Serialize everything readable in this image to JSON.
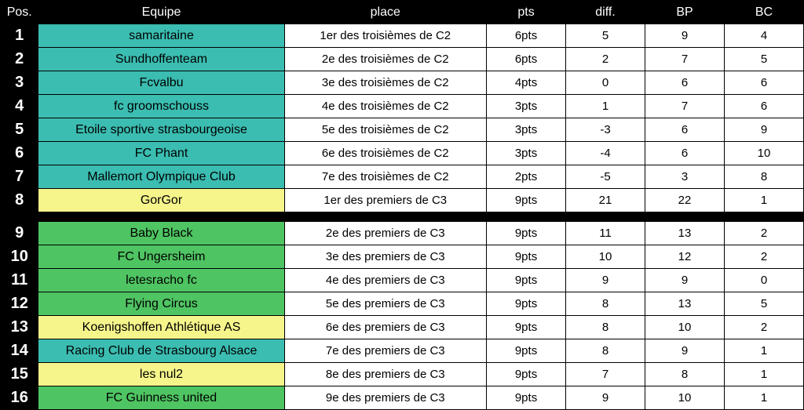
{
  "header": {
    "pos": "Pos.",
    "team": "Equipe",
    "place": "place",
    "pts": "pts",
    "diff": "diff.",
    "bp": "BP",
    "bc": "BC"
  },
  "rows": [
    {
      "pos": 1,
      "team": "samaritaine",
      "place": "1er des troisièmes de C2",
      "pts": "6pts",
      "diff": "5",
      "bp": "9",
      "bc": "4",
      "color": "teal"
    },
    {
      "pos": 2,
      "team": "Sundhoffenteam",
      "place": "2e des troisièmes de C2",
      "pts": "6pts",
      "diff": "2",
      "bp": "7",
      "bc": "5",
      "color": "teal"
    },
    {
      "pos": 3,
      "team": "Fcvalbu",
      "place": "3e des troisièmes de C2",
      "pts": "4pts",
      "diff": "0",
      "bp": "6",
      "bc": "6",
      "color": "teal"
    },
    {
      "pos": 4,
      "team": "fc groomschouss",
      "place": "4e des troisièmes de C2",
      "pts": "3pts",
      "diff": "1",
      "bp": "7",
      "bc": "6",
      "color": "teal"
    },
    {
      "pos": 5,
      "team": "Etoile sportive strasbourgeoise",
      "place": "5e des troisièmes de C2",
      "pts": "3pts",
      "diff": "-3",
      "bp": "6",
      "bc": "9",
      "color": "teal"
    },
    {
      "pos": 6,
      "team": "FC Phant",
      "place": "6e des troisièmes de C2",
      "pts": "3pts",
      "diff": "-4",
      "bp": "6",
      "bc": "10",
      "color": "teal"
    },
    {
      "pos": 7,
      "team": "Mallemort Olympique Club",
      "place": "7e des troisièmes de C2",
      "pts": "2pts",
      "diff": "-5",
      "bp": "3",
      "bc": "8",
      "color": "teal"
    },
    {
      "pos": 8,
      "team": "GorGor",
      "place": "1er des premiers de C3",
      "pts": "9pts",
      "diff": "21",
      "bp": "22",
      "bc": "1",
      "color": "yellow"
    },
    {
      "gap": true
    },
    {
      "pos": 9,
      "team": "Baby Black",
      "place": "2e des premiers de C3",
      "pts": "9pts",
      "diff": "11",
      "bp": "13",
      "bc": "2",
      "color": "green"
    },
    {
      "pos": 10,
      "team": "FC Ungersheim",
      "place": "3e des premiers de C3",
      "pts": "9pts",
      "diff": "10",
      "bp": "12",
      "bc": "2",
      "color": "green"
    },
    {
      "pos": 11,
      "team": "letesracho fc",
      "place": "4e des premiers de C3",
      "pts": "9pts",
      "diff": "9",
      "bp": "9",
      "bc": "0",
      "color": "green"
    },
    {
      "pos": 12,
      "team": "Flying Circus",
      "place": "5e des premiers de C3",
      "pts": "9pts",
      "diff": "8",
      "bp": "13",
      "bc": "5",
      "color": "green"
    },
    {
      "pos": 13,
      "team": "Koenigshoffen Athlétique AS",
      "place": "6e des premiers de C3",
      "pts": "9pts",
      "diff": "8",
      "bp": "10",
      "bc": "2",
      "color": "yellow"
    },
    {
      "pos": 14,
      "team": "Racing Club de Strasbourg Alsace",
      "place": "7e des premiers de C3",
      "pts": "9pts",
      "diff": "8",
      "bp": "9",
      "bc": "1",
      "color": "teal"
    },
    {
      "pos": 15,
      "team": "les nul2",
      "place": "8e des premiers de C3",
      "pts": "9pts",
      "diff": "7",
      "bp": "8",
      "bc": "1",
      "color": "yellow"
    },
    {
      "pos": 16,
      "team": "FC Guinness united",
      "place": "9e des premiers de C3",
      "pts": "9pts",
      "diff": "9",
      "bp": "10",
      "bc": "1",
      "color": "green"
    }
  ],
  "chart_data": {
    "type": "table",
    "title": "",
    "columns": [
      "Pos.",
      "Equipe",
      "place",
      "pts",
      "diff.",
      "BP",
      "BC"
    ],
    "groups": [
      {
        "range": "1-7",
        "description": "troisièmes de C2",
        "team_cell_color": "#3bbdb1"
      },
      {
        "range": "8",
        "description": "premiers de C3",
        "team_cell_color": "#f6f58b"
      },
      {
        "range": "9-16",
        "description": "premiers de C3 (continued)",
        "team_cell_color": "mixed"
      }
    ],
    "rows": [
      {
        "Pos.": 1,
        "Equipe": "samaritaine",
        "place": "1er des troisièmes de C2",
        "pts": 6,
        "diff.": 5,
        "BP": 9,
        "BC": 4
      },
      {
        "Pos.": 2,
        "Equipe": "Sundhoffenteam",
        "place": "2e des troisièmes de C2",
        "pts": 6,
        "diff.": 2,
        "BP": 7,
        "BC": 5
      },
      {
        "Pos.": 3,
        "Equipe": "Fcvalbu",
        "place": "3e des troisièmes de C2",
        "pts": 4,
        "diff.": 0,
        "BP": 6,
        "BC": 6
      },
      {
        "Pos.": 4,
        "Equipe": "fc groomschouss",
        "place": "4e des troisièmes de C2",
        "pts": 3,
        "diff.": 1,
        "BP": 7,
        "BC": 6
      },
      {
        "Pos.": 5,
        "Equipe": "Etoile sportive strasbourgeoise",
        "place": "5e des troisièmes de C2",
        "pts": 3,
        "diff.": -3,
        "BP": 6,
        "BC": 9
      },
      {
        "Pos.": 6,
        "Equipe": "FC Phant",
        "place": "6e des troisièmes de C2",
        "pts": 3,
        "diff.": -4,
        "BP": 6,
        "BC": 10
      },
      {
        "Pos.": 7,
        "Equipe": "Mallemort Olympique Club",
        "place": "7e des troisièmes de C2",
        "pts": 2,
        "diff.": -5,
        "BP": 3,
        "BC": 8
      },
      {
        "Pos.": 8,
        "Equipe": "GorGor",
        "place": "1er des premiers de C3",
        "pts": 9,
        "diff.": 21,
        "BP": 22,
        "BC": 1
      },
      {
        "Pos.": 9,
        "Equipe": "Baby Black",
        "place": "2e des premiers de C3",
        "pts": 9,
        "diff.": 11,
        "BP": 13,
        "BC": 2
      },
      {
        "Pos.": 10,
        "Equipe": "FC Ungersheim",
        "place": "3e des premiers de C3",
        "pts": 9,
        "diff.": 10,
        "BP": 12,
        "BC": 2
      },
      {
        "Pos.": 11,
        "Equipe": "letesracho fc",
        "place": "4e des premiers de C3",
        "pts": 9,
        "diff.": 9,
        "BP": 9,
        "BC": 0
      },
      {
        "Pos.": 12,
        "Equipe": "Flying Circus",
        "place": "5e des premiers de C3",
        "pts": 9,
        "diff.": 8,
        "BP": 13,
        "BC": 5
      },
      {
        "Pos.": 13,
        "Equipe": "Koenigshoffen Athlétique AS",
        "place": "6e des premiers de C3",
        "pts": 9,
        "diff.": 8,
        "BP": 10,
        "BC": 2
      },
      {
        "Pos.": 14,
        "Equipe": "Racing Club de Strasbourg Alsace",
        "place": "7e des premiers de C3",
        "pts": 9,
        "diff.": 8,
        "BP": 9,
        "BC": 1
      },
      {
        "Pos.": 15,
        "Equipe": "les nul2",
        "place": "8e des premiers de C3",
        "pts": 9,
        "diff.": 7,
        "BP": 8,
        "BC": 1
      },
      {
        "Pos.": 16,
        "Equipe": "FC Guinness united",
        "place": "9e des premiers de C3",
        "pts": 9,
        "diff.": 9,
        "BP": 10,
        "BC": 1
      }
    ]
  }
}
